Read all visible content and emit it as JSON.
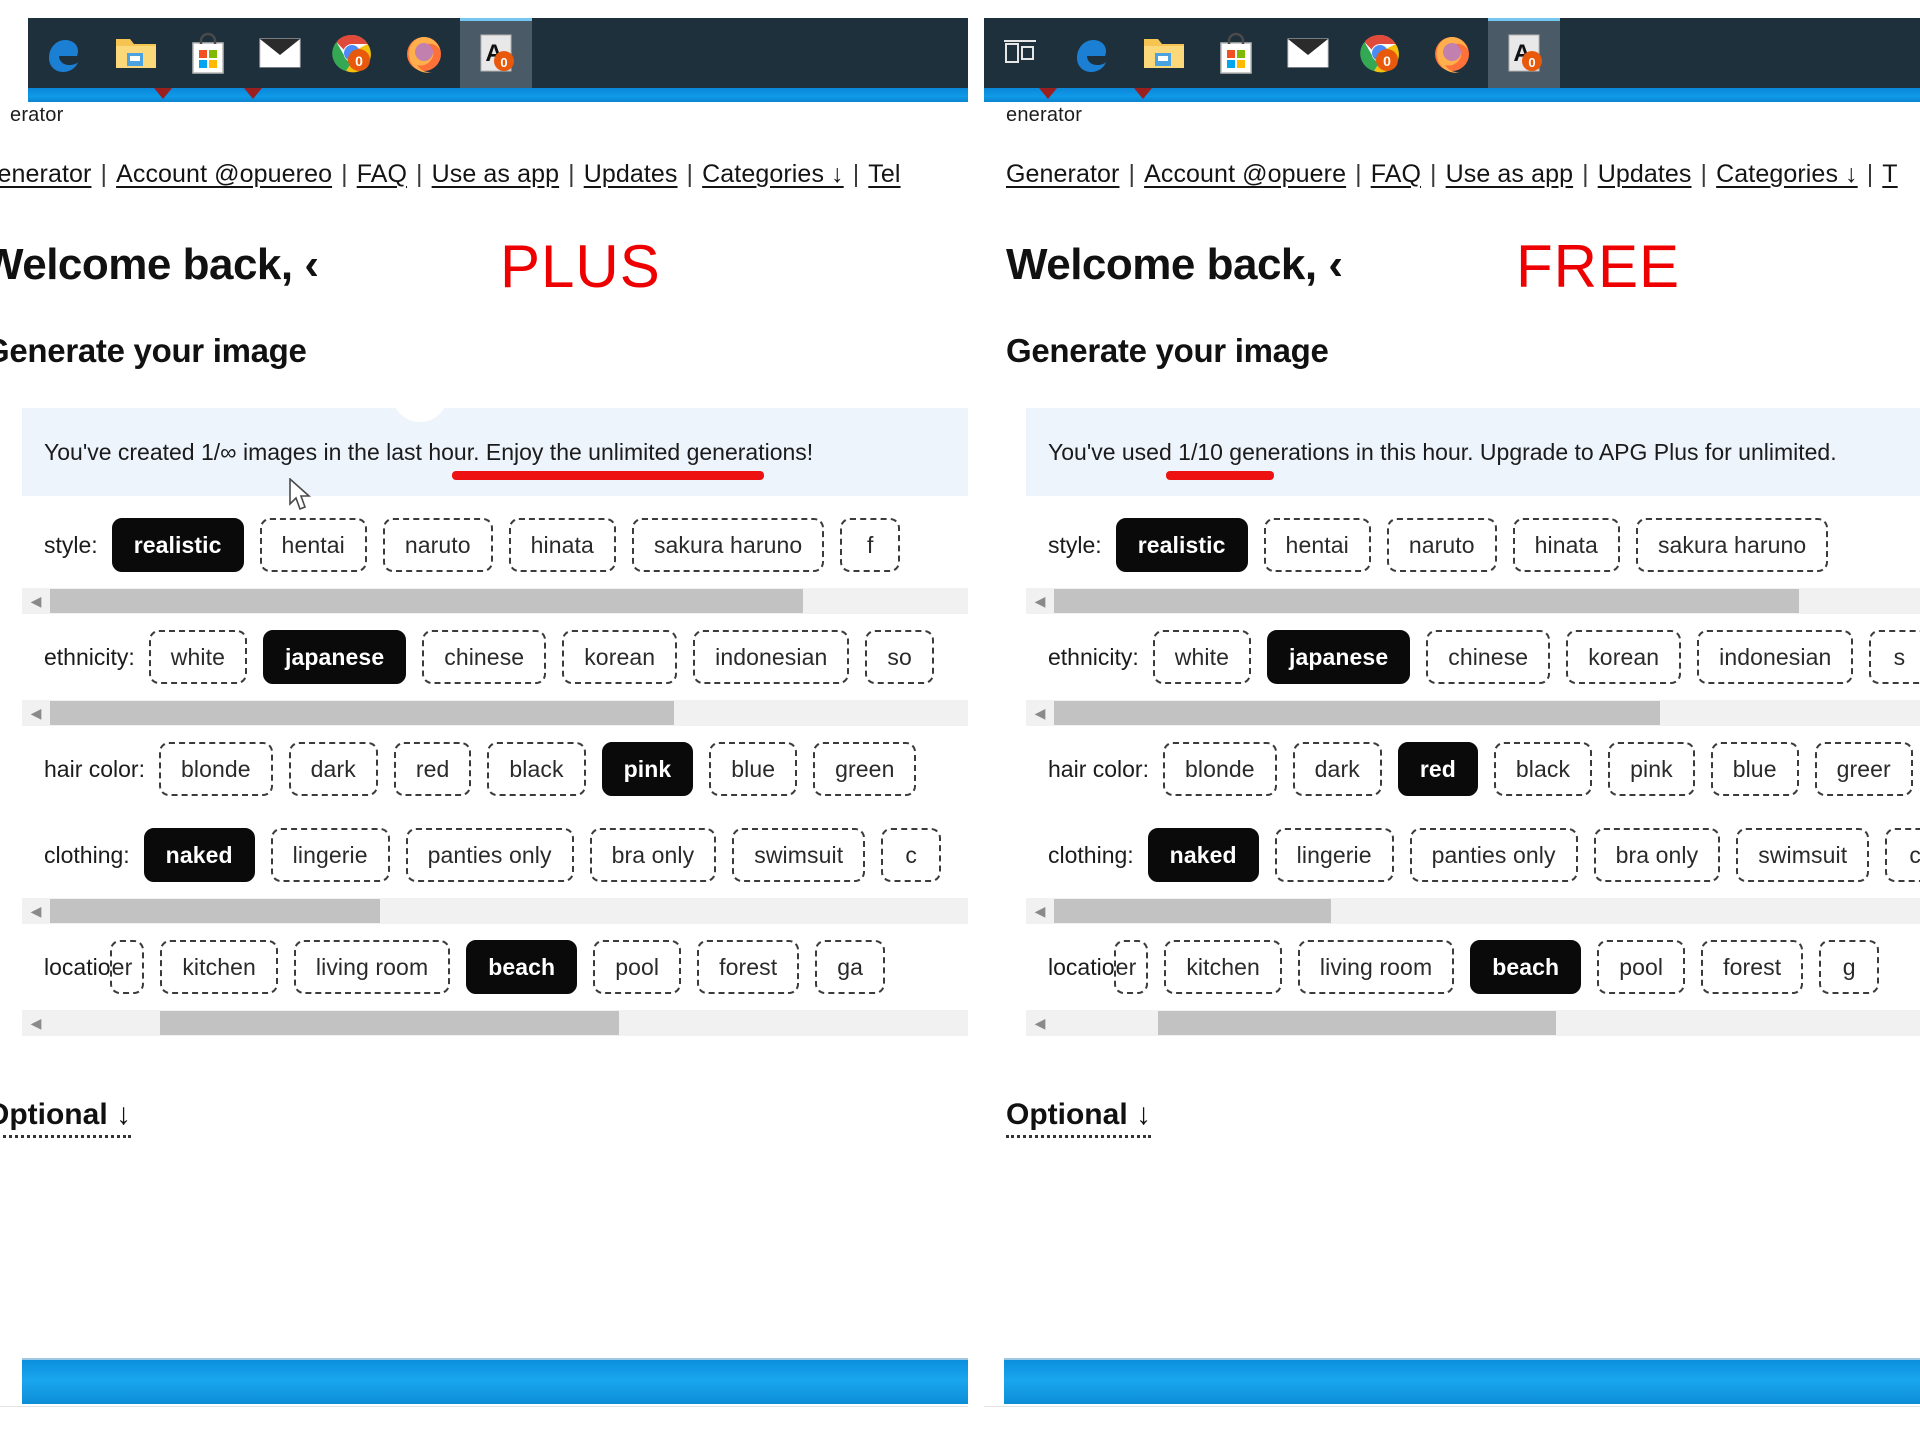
{
  "window": {
    "taskbar": {
      "icons_left": [
        {
          "name": "task-view-icon",
          "label": "Task View"
        },
        {
          "name": "edge-icon",
          "label": "Microsoft Edge"
        },
        {
          "name": "file-explorer-icon",
          "label": "File Explorer"
        },
        {
          "name": "microsoft-store-icon",
          "label": "Microsoft Store"
        },
        {
          "name": "mail-icon",
          "label": "Mail"
        },
        {
          "name": "chrome-icon",
          "label": "Google Chrome",
          "badge": "0"
        },
        {
          "name": "firefox-icon",
          "label": "Firefox"
        },
        {
          "name": "app-icon",
          "label": "A",
          "badge": "0",
          "active": true
        }
      ],
      "icons_right": [
        {
          "name": "edge-icon",
          "label": "Microsoft Edge"
        },
        {
          "name": "file-explorer-icon",
          "label": "File Explorer"
        },
        {
          "name": "microsoft-store-icon",
          "label": "Microsoft Store"
        },
        {
          "name": "mail-icon",
          "label": "Mail"
        },
        {
          "name": "chrome-icon",
          "label": "Google Chrome",
          "badge": "0"
        },
        {
          "name": "firefox-icon",
          "label": "Firefox"
        },
        {
          "name": "app-icon",
          "label": "A",
          "badge": "0",
          "active": true
        }
      ]
    }
  },
  "colors": {
    "accent_red": "#ee0000",
    "banner_bg": "#eef4fc",
    "chip_selected_bg": "#0a0a0a",
    "taskbar_bg": "#1f303d",
    "desktop_blue": "#0f9ae8"
  },
  "left": {
    "tier": "PLUS",
    "crumb": "erator",
    "nav": [
      {
        "label": "Generator"
      },
      {
        "label": "Account @opuereo"
      },
      {
        "label": "FAQ"
      },
      {
        "label": "Use as app"
      },
      {
        "label": "Updates"
      },
      {
        "label": "Categories ↓"
      },
      {
        "label": "Tel"
      }
    ],
    "nav_separator": "|",
    "welcome": "Welcome back, ‹",
    "section_title": "Generate your image",
    "quota_text": "You've created 1/∞ images in the last hour. Enjoy the unlimited generations!",
    "optional_label": "Optional ↓",
    "rows": [
      {
        "label": "style:",
        "selected": "realistic",
        "chips": [
          "realistic",
          "hentai",
          "naruto",
          "hinata",
          "sakura haruno",
          "f"
        ],
        "scroll_pct": 82,
        "scroll_offset_pct": 0
      },
      {
        "label": "ethnicity:",
        "selected": "japanese",
        "chips": [
          "white",
          "japanese",
          "chinese",
          "korean",
          "indonesian",
          "so"
        ],
        "scroll_pct": 68,
        "scroll_offset_pct": 0
      },
      {
        "label": "hair color:",
        "selected": "pink",
        "chips": [
          "blonde",
          "dark",
          "red",
          "black",
          "pink",
          "blue",
          "green"
        ],
        "scroll_pct": 0,
        "scroll_offset_pct": 0
      },
      {
        "label": "clothing:",
        "selected": "naked",
        "chips": [
          "naked",
          "lingerie",
          "panties only",
          "bra only",
          "swimsuit",
          "c"
        ],
        "scroll_pct": 36,
        "scroll_offset_pct": 0
      },
      {
        "label": "location:",
        "selected": "beach",
        "clipped_first": "er",
        "chips": [
          "kitchen",
          "living room",
          "beach",
          "pool",
          "forest",
          "ga"
        ],
        "scroll_pct": 62,
        "scroll_offset_pct": 12
      }
    ]
  },
  "right": {
    "tier": "FREE",
    "crumb": "enerator",
    "nav": [
      {
        "label": "Generator"
      },
      {
        "label": "Account @opuere"
      },
      {
        "label": "FAQ"
      },
      {
        "label": "Use as app"
      },
      {
        "label": "Updates"
      },
      {
        "label": "Categories ↓"
      },
      {
        "label": "T"
      }
    ],
    "nav_separator": "|",
    "welcome": "Welcome back, ‹",
    "section_title": "Generate your image",
    "quota_text": "You've used 1/10 generations in this hour. Upgrade to APG Plus for unlimited.",
    "optional_label": "Optional ↓",
    "rows": [
      {
        "label": "style:",
        "selected": "realistic",
        "chips": [
          "realistic",
          "hentai",
          "naruto",
          "hinata",
          "sakura haruno"
        ],
        "scroll_pct": 86,
        "scroll_offset_pct": 0
      },
      {
        "label": "ethnicity:",
        "selected": "japanese",
        "chips": [
          "white",
          "japanese",
          "chinese",
          "korean",
          "indonesian",
          "s"
        ],
        "scroll_pct": 70,
        "scroll_offset_pct": 0
      },
      {
        "label": "hair color:",
        "selected": "red",
        "chips": [
          "blonde",
          "dark",
          "red",
          "black",
          "pink",
          "blue",
          "greer"
        ],
        "scroll_pct": 0,
        "scroll_offset_pct": 0
      },
      {
        "label": "clothing:",
        "selected": "naked",
        "chips": [
          "naked",
          "lingerie",
          "panties only",
          "bra only",
          "swimsuit",
          "c"
        ],
        "scroll_pct": 32,
        "scroll_offset_pct": 0
      },
      {
        "label": "location:",
        "selected": "beach",
        "clipped_first": "er",
        "chips": [
          "kitchen",
          "living room",
          "beach",
          "pool",
          "forest",
          "g"
        ],
        "scroll_pct": 58,
        "scroll_offset_pct": 12
      }
    ]
  }
}
